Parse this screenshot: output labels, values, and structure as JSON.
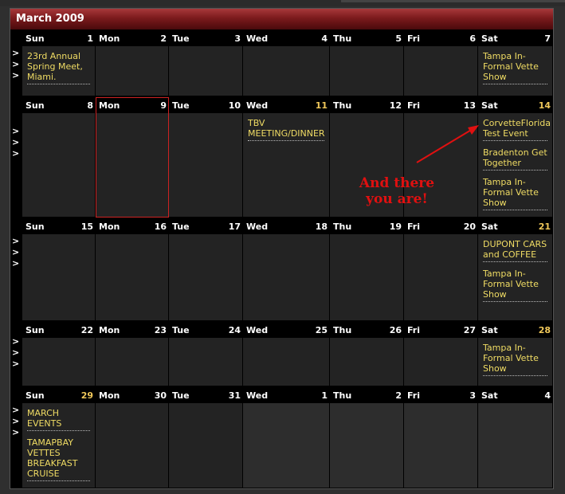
{
  "calendar": {
    "month_title": "March 2009",
    "annotation": "And there you are!",
    "colors": {
      "event_text": "#f0dc64",
      "highlight_date": "#f0c85a",
      "annotation": "#e01010",
      "header_gradient": "#7b1a1c"
    },
    "gutter_arrow": ">",
    "weeks": [
      {
        "days": [
          {
            "name": "Sun",
            "date": "1",
            "events": [
              "23rd Annual Spring Meet, Miami."
            ]
          },
          {
            "name": "Mon",
            "date": "2",
            "events": []
          },
          {
            "name": "Tue",
            "date": "3",
            "events": []
          },
          {
            "name": "Wed",
            "date": "4",
            "events": []
          },
          {
            "name": "Thu",
            "date": "5",
            "events": []
          },
          {
            "name": "Fri",
            "date": "6",
            "events": []
          },
          {
            "name": "Sat",
            "date": "7",
            "events": [
              "Tampa In-Formal Vette Show"
            ]
          }
        ]
      },
      {
        "days": [
          {
            "name": "Sun",
            "date": "8",
            "events": []
          },
          {
            "name": "Mon",
            "date": "9",
            "events": [],
            "selected": true
          },
          {
            "name": "Tue",
            "date": "10",
            "events": []
          },
          {
            "name": "Wed",
            "date": "11",
            "events": [
              "TBV MEETING/DINNER"
            ],
            "highlight": true
          },
          {
            "name": "Thu",
            "date": "12",
            "events": []
          },
          {
            "name": "Fri",
            "date": "13",
            "events": []
          },
          {
            "name": "Sat",
            "date": "14",
            "events": [
              "CorvetteFlorida Test Event",
              "Bradenton Get Together",
              "Tampa In-Formal Vette Show"
            ],
            "highlight": true
          }
        ]
      },
      {
        "days": [
          {
            "name": "Sun",
            "date": "15",
            "events": []
          },
          {
            "name": "Mon",
            "date": "16",
            "events": []
          },
          {
            "name": "Tue",
            "date": "17",
            "events": []
          },
          {
            "name": "Wed",
            "date": "18",
            "events": []
          },
          {
            "name": "Thu",
            "date": "19",
            "events": []
          },
          {
            "name": "Fri",
            "date": "20",
            "events": []
          },
          {
            "name": "Sat",
            "date": "21",
            "events": [
              "DUPONT CARS and COFFEE",
              "Tampa In-Formal Vette Show"
            ],
            "highlight": true
          }
        ]
      },
      {
        "days": [
          {
            "name": "Sun",
            "date": "22",
            "events": []
          },
          {
            "name": "Mon",
            "date": "23",
            "events": []
          },
          {
            "name": "Tue",
            "date": "24",
            "events": []
          },
          {
            "name": "Wed",
            "date": "25",
            "events": []
          },
          {
            "name": "Thu",
            "date": "26",
            "events": []
          },
          {
            "name": "Fri",
            "date": "27",
            "events": []
          },
          {
            "name": "Sat",
            "date": "28",
            "events": [
              "Tampa In-Formal Vette Show"
            ],
            "highlight": true
          }
        ]
      },
      {
        "days": [
          {
            "name": "Sun",
            "date": "29",
            "events": [
              "MARCH EVENTS",
              "TAMAPBAY VETTES BREAKFAST CRUISE"
            ],
            "highlight": true
          },
          {
            "name": "Mon",
            "date": "30",
            "events": []
          },
          {
            "name": "Tue",
            "date": "31",
            "events": []
          },
          {
            "name": "Wed",
            "date": "1",
            "events": [],
            "other": true
          },
          {
            "name": "Thu",
            "date": "2",
            "events": [],
            "other": true
          },
          {
            "name": "Fri",
            "date": "3",
            "events": [],
            "other": true
          },
          {
            "name": "Sat",
            "date": "4",
            "events": [],
            "other": true
          }
        ]
      }
    ]
  }
}
